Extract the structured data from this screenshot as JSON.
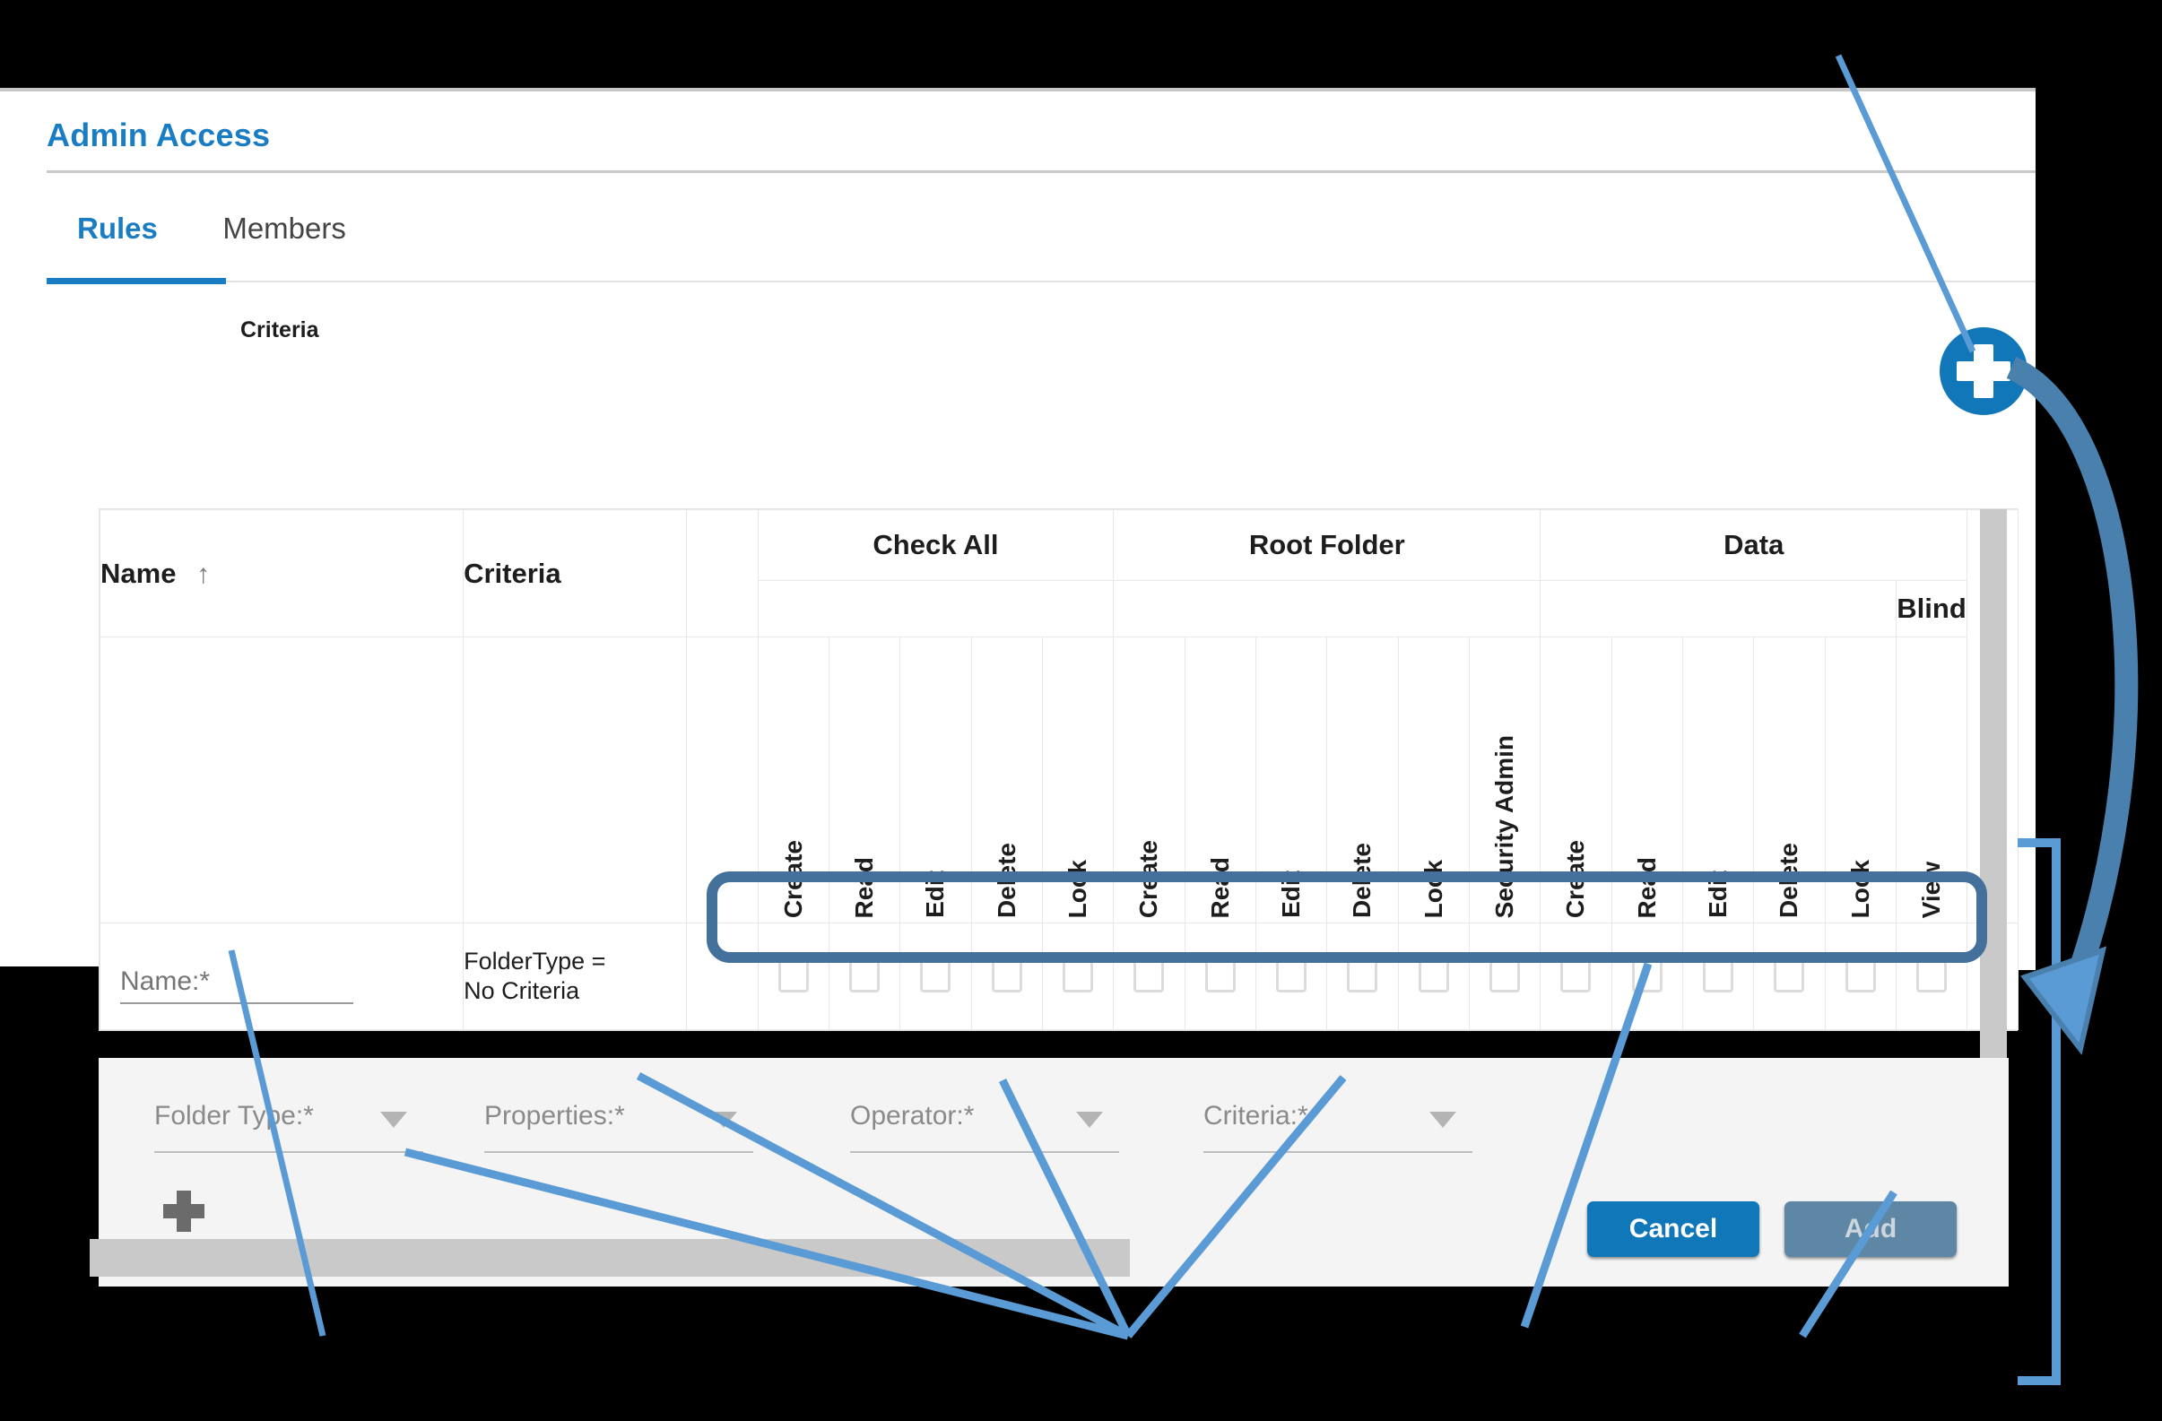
{
  "panel": {
    "title": "Admin Access",
    "tabs": [
      {
        "label": "Rules",
        "active": true
      },
      {
        "label": "Members",
        "active": false
      }
    ]
  },
  "grid": {
    "caption": "Criteria",
    "columns": {
      "name": {
        "label": "Name",
        "sort_icon": "sort-ascending-icon"
      },
      "criteria": {
        "label": "Criteria"
      }
    },
    "groups": [
      {
        "label": "Check All",
        "subgroup": "",
        "permissions": [
          "Create",
          "Read",
          "Edit",
          "Delete",
          "Lock"
        ]
      },
      {
        "label": "Root Folder",
        "subgroup": "",
        "permissions": [
          "Create",
          "Read",
          "Edit",
          "Delete",
          "Lock",
          "Security Admin"
        ]
      },
      {
        "label": "Data",
        "subgroup": "",
        "permissions": [
          "Create",
          "Read",
          "Edit",
          "Delete",
          "Lock"
        ]
      },
      {
        "label": "",
        "subgroup": "Blind",
        "permissions": [
          "View"
        ]
      }
    ],
    "row": {
      "name_placeholder": "Name:*",
      "name_value": "",
      "criteria_text_line1": "FolderType =",
      "criteria_text_line2": "No Criteria",
      "checkbox_count": 17,
      "checkbox_checked": false
    }
  },
  "form": {
    "fields": [
      {
        "label": "Folder Type:*",
        "value": "",
        "icon": "chevron-down-icon"
      },
      {
        "label": "Properties:*",
        "value": "",
        "icon": "chevron-down-icon"
      },
      {
        "label": "Operator:*",
        "value": "",
        "icon": "chevron-down-icon"
      },
      {
        "label": "Criteria:*",
        "value": "",
        "icon": "chevron-down-icon"
      }
    ],
    "add_criteria_icon": "plus-icon",
    "buttons": {
      "cancel": "Cancel",
      "add": "Add"
    }
  },
  "fab": {
    "icon": "plus-icon"
  },
  "colors": {
    "accent": "#1a7dc4",
    "fab": "#1277b8",
    "cancel_button": "#1077b8",
    "add_button_disabled": "#5d87a4",
    "annotation": "#5b9bd5",
    "highlight_outline": "#44719b",
    "panel_background": "#ffffff",
    "row_background": "#f4f4f4"
  }
}
